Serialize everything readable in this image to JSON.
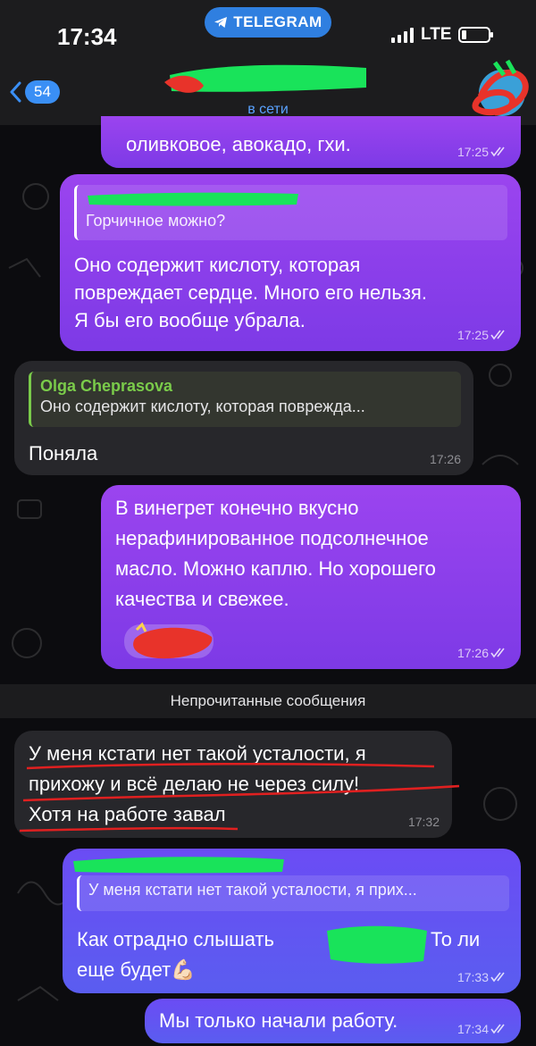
{
  "status_bar": {
    "time": "17:34",
    "app_pill": "TELEGRAM",
    "network": "LTE"
  },
  "header": {
    "back_count": "54",
    "subtitle": "в сети"
  },
  "messages": [
    {
      "id": "m1",
      "direction": "outgoing",
      "text": "оливковое, авокадо, гхи.",
      "time": "17:25"
    },
    {
      "id": "m2",
      "direction": "outgoing",
      "reply_text": "Горчичное можно?",
      "lines": [
        "Оно содержит кислоту, которая",
        "повреждает сердце. Много его нельзя.",
        "Я бы его вообще убрала."
      ],
      "time": "17:25"
    },
    {
      "id": "m3",
      "direction": "incoming",
      "reply_name": "Olga Cheprasova",
      "reply_text": "Оно содержит кислоту, которая повреждa...",
      "text": "Поняла",
      "time": "17:26"
    },
    {
      "id": "m4",
      "direction": "outgoing",
      "lines": [
        "В винегрет конечно вкусно",
        "нерафинированное подсолнечное",
        "масло. Можно каплю. Но хорошего",
        "качества и свежее."
      ],
      "time": "17:26"
    },
    {
      "id": "m5",
      "direction": "incoming",
      "lines": [
        "У меня кстати нет такой усталости, я",
        "прихожу и всё делаю не через силу!",
        "Хотя на работе завал"
      ],
      "time": "17:32"
    },
    {
      "id": "m6",
      "direction": "outgoing",
      "reply_text": "У меня кстати нет такой усталости, я прих...",
      "line1_left": "Как отрадно слышать",
      "line1_right": "То ли",
      "line2": "еще будет💪🏻",
      "time": "17:33"
    },
    {
      "id": "m7",
      "direction": "outgoing",
      "text": "Мы только начали работу.",
      "time": "17:34"
    }
  ],
  "unread_divider": "Непрочитанные сообщения",
  "colors": {
    "outgoing_purple": "#8a3fea",
    "outgoing_blue": "#5f55f2",
    "incoming": "#27272b",
    "accent_blue": "#3a8ff5",
    "reply_name_green": "#7acb4a",
    "redaction_green": "#19e35a",
    "redaction_red": "#e8332a"
  }
}
